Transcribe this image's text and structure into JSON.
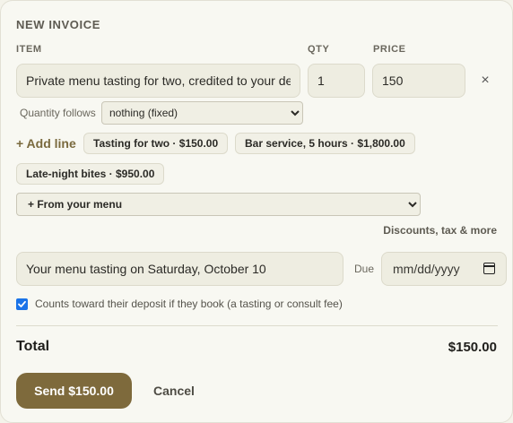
{
  "header": {
    "title": "NEW INVOICE"
  },
  "columns": {
    "item": "ITEM",
    "qty": "QTY",
    "price": "PRICE"
  },
  "line_item": {
    "description": "Private menu tasting for two, credited to your deposit if you book",
    "qty": "1",
    "price": "150",
    "remove_icon": "×"
  },
  "quantity_follows": {
    "label": "Quantity follows",
    "selected": "nothing (fixed)"
  },
  "add_line": {
    "label": "+ Add line"
  },
  "quick_add_chips": [
    "Tasting for two · $150.00",
    "Bar service, 5 hours · $1,800.00",
    "Late-night bites · $950.00"
  ],
  "menu_select": {
    "selected": "+ From your menu"
  },
  "discounts_link": "Discounts, tax & more",
  "memo": {
    "value": "Your menu tasting on Saturday, October 10"
  },
  "due": {
    "label": "Due",
    "placeholder": "mm/dd/yyyy"
  },
  "deposit_checkbox": {
    "checked": true,
    "label": "Counts toward their deposit if they book (a tasting or consult fee)"
  },
  "totals": {
    "label": "Total",
    "value": "$150.00"
  },
  "actions": {
    "send": "Send $150.00",
    "cancel": "Cancel"
  },
  "colors": {
    "accent": "#7e6a3c",
    "background": "#f8f8f2",
    "checkbox": "#1a73e8"
  },
  "icons": {
    "remove": "close-icon",
    "calendar": "calendar-icon",
    "check": "check-icon"
  }
}
